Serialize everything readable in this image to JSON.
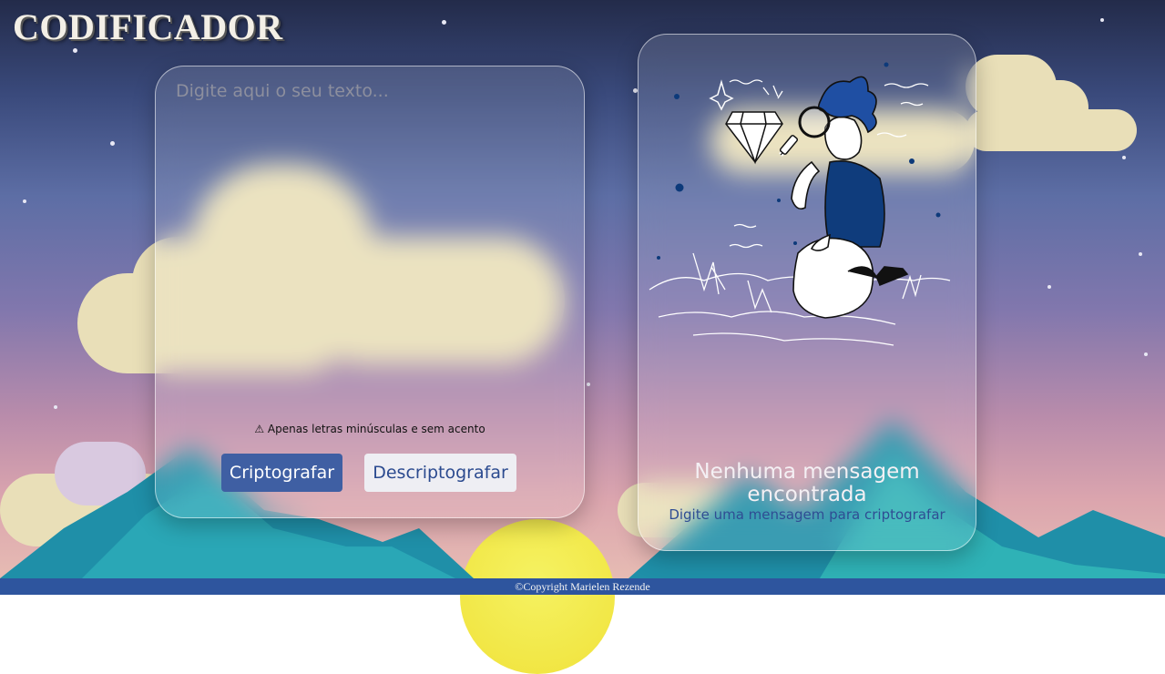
{
  "app": {
    "title": "CODIFICADOR"
  },
  "input": {
    "placeholder": "Digite aqui o seu texto...",
    "value": ""
  },
  "warning": {
    "text": "⚠ Apenas letras minúsculas e sem acento"
  },
  "buttons": {
    "encrypt_label": "Criptografar",
    "decrypt_label": "Descriptografar"
  },
  "output": {
    "illustration_icon": "person-with-magnifier-and-diamond",
    "title": "Nenhuma mensagem encontrada",
    "subtitle": "Digite uma mensagem para criptografar"
  },
  "footer": {
    "text": "©Copyright Marielen Rezende"
  },
  "colors": {
    "primary": "#3f5fa3",
    "footer": "#2e559e",
    "secondary_button": "#eeeef3"
  }
}
